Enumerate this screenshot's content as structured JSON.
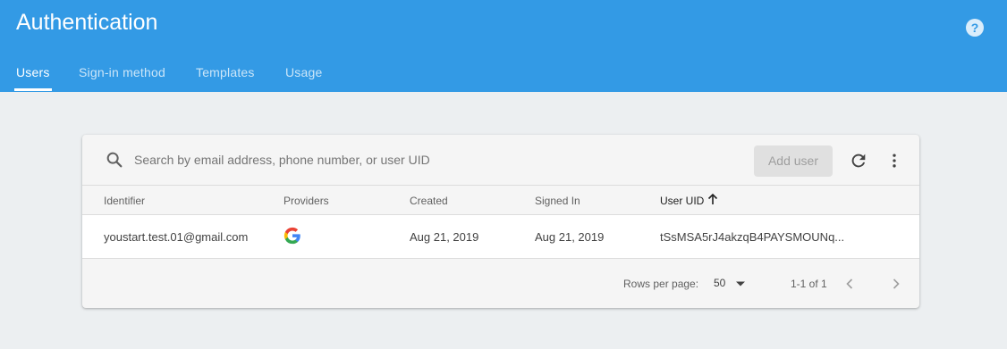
{
  "app": {
    "title": "Authentication",
    "help_icon": "help-icon",
    "help_glyph": "?"
  },
  "tabs": [
    {
      "label": "Users",
      "active": true
    },
    {
      "label": "Sign-in method",
      "active": false
    },
    {
      "label": "Templates",
      "active": false
    },
    {
      "label": "Usage",
      "active": false
    }
  ],
  "toolbar": {
    "search_placeholder": "Search by email address, phone number, or user UID",
    "add_user_label": "Add user",
    "refresh_icon": "refresh-icon",
    "more_icon": "more-vert-icon"
  },
  "table": {
    "columns": [
      "Identifier",
      "Providers",
      "Created",
      "Signed In",
      "User UID"
    ],
    "sorted_column": "User UID",
    "sort_direction": "ascending",
    "rows": [
      {
        "identifier": "youstart.test.01@gmail.com",
        "provider_icon": "google-icon",
        "created": "Aug 21, 2019",
        "signed_in": "Aug 21, 2019",
        "uid": "tSsMSA5rJ4akzqB4PAYSMOUNq..."
      }
    ]
  },
  "pagination": {
    "rows_per_page_label": "Rows per page:",
    "rows_per_page_value": "50",
    "range_label": "1-1 of 1"
  },
  "colors": {
    "header": "#339ae5",
    "background": "#eceff1",
    "card": "#f5f5f5"
  }
}
